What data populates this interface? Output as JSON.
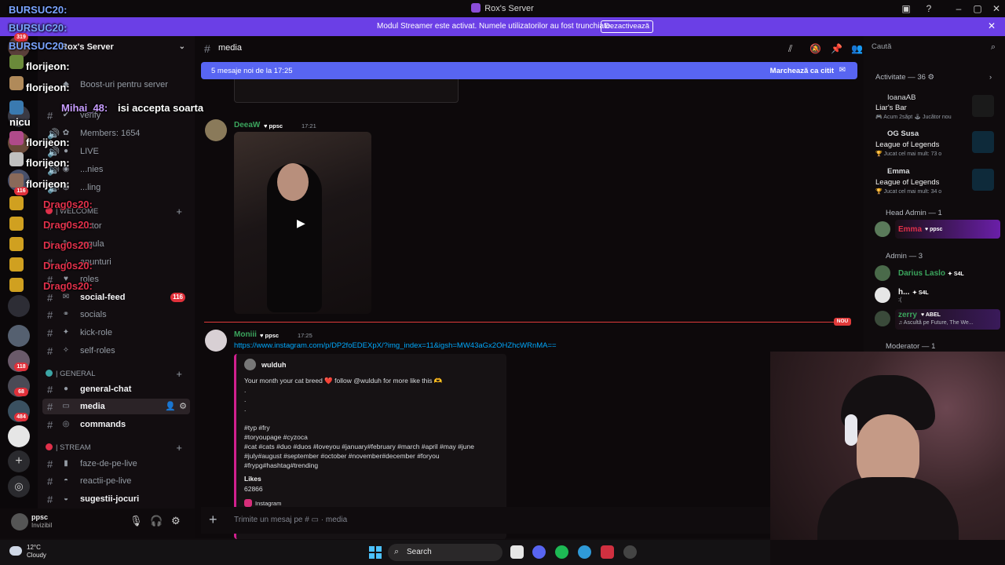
{
  "window": {
    "title": "Rox's Server"
  },
  "banner": {
    "message": "Modul Streamer este activat. Numele utilizatorilor au fost trunchiate.",
    "button": "Dezactivează"
  },
  "rail": {
    "badges": [
      "319",
      "116",
      "118",
      "68",
      "484"
    ]
  },
  "sidebar": {
    "server_name": "Rox's Server",
    "channels_top": [
      {
        "label": "Boost-uri pentru server",
        "emoji": "◆"
      },
      {
        "label": "verify",
        "emoji": "✔"
      },
      {
        "label": "Members: 1654",
        "emoji": "✿"
      },
      {
        "label": "LIVE",
        "emoji": "●"
      },
      {
        "label": "...nies",
        "emoji": "◉"
      },
      {
        "label": "...ling",
        "emoji": "◍"
      }
    ],
    "category_welcome": "| WELCOME",
    "welcome_channels": [
      {
        "label": "...ctor",
        "emoji": "★"
      },
      {
        "label": "regula",
        "emoji": "✎"
      },
      {
        "label": "anunturi",
        "emoji": "♪"
      },
      {
        "label": "roles",
        "emoji": "♥"
      },
      {
        "label": "social-feed",
        "emoji": "✉",
        "badge": "116",
        "bright": true
      },
      {
        "label": "socials",
        "emoji": "⚭"
      },
      {
        "label": "kick-role",
        "emoji": "✦"
      },
      {
        "label": "self-roles",
        "emoji": "✧"
      }
    ],
    "category_general": "| GENERAL",
    "general_channels": [
      {
        "label": "general-chat",
        "emoji": "●",
        "bright": true
      },
      {
        "label": "media",
        "emoji": "▭",
        "bright": true,
        "active": true
      },
      {
        "label": "commands",
        "emoji": "◎",
        "bright": true
      }
    ],
    "category_stream": "| STREAM",
    "stream_channels": [
      {
        "label": "faze-de-pe-live",
        "emoji": "▮"
      },
      {
        "label": "reactii-pe-live",
        "emoji": "◓"
      },
      {
        "label": "sugestii-jocuri",
        "emoji": "◒",
        "bright": true
      }
    ]
  },
  "user_panel": {
    "name": "ppsc",
    "status": "Invizibil"
  },
  "chat": {
    "channel_name": "media",
    "new_messages": "5 mesaje noi de la 17:25",
    "mark_read": "Marchează ca citit",
    "new_label": "NOU",
    "messages": [
      {
        "author": "DeeaW",
        "tag": "ppsc",
        "time": "17:21",
        "author_color": "#3ba55d"
      },
      {
        "author": "Moniii",
        "tag": "ppsc",
        "time": "17:25",
        "author_color": "#3ba55d",
        "link": "https://www.instagram.com/p/DP2foEDEXpX/?img_index=11&igsh=MW43aGx2OHZhcWRnMA==",
        "embed": {
          "name": "wulduh",
          "caption": "Your month your cat breed ❤️ follow @wulduh for more like this 🫶",
          "dots": [
            ".",
            ".",
            "."
          ],
          "tags_line1": "#typ #fry",
          "tags_line2": "#toryoupage #cyzoca",
          "tags_line3": "#cat #cats #duo #duos #loveyou #january#february #march #april #may #june",
          "tags_line4": "#july#august #september #october #november#december #foryou",
          "tags_line5": "#frypg#hashtag#trending",
          "likes_label": "Likes",
          "likes_value": "62866",
          "footer": "Instagram"
        }
      }
    ],
    "composer_placeholder": "Trimite un mesaj pe # ▭ · media"
  },
  "right_panel": {
    "search_placeholder": "Caută",
    "activity_header": "Activitate — 36 ⚙",
    "activities": [
      {
        "name": "IoanaAB",
        "game": "Liar's Bar",
        "sub": "🎮 Acum 2săpt  🕹 Jucător nou",
        "color": "#a49ef5",
        "box": "#1a1a1a"
      },
      {
        "name": "OG Susa",
        "game": "League of Legends",
        "sub": "🏆 Jucat cel mai mult: 73 o",
        "color": "#a49ef5",
        "box": "#0e2a3a"
      },
      {
        "name": "Emma",
        "game": "League of Legends",
        "sub": "🏆 Jucat cel mai mult: 34 o",
        "color": "#e0304a",
        "box": "#0e2a3a"
      }
    ],
    "head_admin_header": "Head Admin — 1",
    "head_admins": [
      {
        "name": "Emma",
        "tag": "ppsc",
        "color": "#e0304a"
      }
    ],
    "admin_header": "Admin — 3",
    "admins": [
      {
        "name": "Darius Laslo",
        "tag": "S4L",
        "color": "#3ba55d",
        "sub": ""
      },
      {
        "name": "h...",
        "tag": "S4L",
        "color": "#f2f2f2",
        "sub": ":("
      },
      {
        "name": "zerry",
        "tag": "ABEL",
        "color": "#3ba55d",
        "sub": "♫ Ascultă pe Future, The We..."
      }
    ],
    "moderator_header": "Moderator — 1"
  },
  "overlay_chat": [
    {
      "name": "BURSUC20:",
      "color": "#7aa4ff"
    },
    {
      "name": "BURSUC20:",
      "color": "#7aa4ff"
    },
    {
      "name": "BURSUC20:",
      "color": "#7aa4ff"
    },
    {
      "name": "florijeon:",
      "color": "#ffffff"
    },
    {
      "name": "florijeon:",
      "color": "#ffffff"
    },
    {
      "name": "Mihai_48:",
      "color": "#c89cff",
      "text": "isi accepta soarta"
    },
    {
      "name": "nicu",
      "color": "#ffffff"
    },
    {
      "name": "florijeon:",
      "color": "#ffffff"
    },
    {
      "name": "florijeon:",
      "color": "#ffffff"
    },
    {
      "name": "florijeon:",
      "color": "#ffffff"
    },
    {
      "name": "Drag0s20:",
      "color": "#e0304a"
    },
    {
      "name": "Drag0s20:",
      "color": "#e0304a"
    },
    {
      "name": "Drag0s20:",
      "color": "#e0304a"
    },
    {
      "name": "Drag0s20:",
      "color": "#e0304a"
    },
    {
      "name": "Drag0s20:",
      "color": "#e0304a"
    }
  ],
  "taskbar": {
    "temp": "12°C",
    "weather": "Cloudy",
    "search_label": "Search"
  }
}
